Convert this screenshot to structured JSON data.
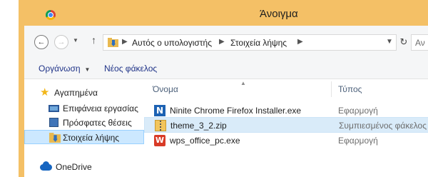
{
  "window": {
    "title": "Άνοιγμα",
    "colors": {
      "frame": "#f4c066",
      "selection": "#cce8ff",
      "link": "#1e3287"
    }
  },
  "nav": {
    "back_icon": "back-arrow-icon",
    "forward_icon": "forward-arrow-icon",
    "up_icon": "up-arrow-icon",
    "breadcrumb": [
      "Αυτός ο υπολογιστής",
      "Στοιχεία λήψης"
    ],
    "search_placeholder": "Αν"
  },
  "commands": {
    "organize": "Οργάνωση",
    "new_folder": "Νέος φάκελος"
  },
  "sidebar": {
    "items": [
      {
        "label": "Αγαπημένα",
        "icon": "star-icon"
      },
      {
        "label": "Επιφάνεια εργασίας",
        "icon": "desktop-icon"
      },
      {
        "label": "Πρόσφατες θέσεις",
        "icon": "recent-places-icon"
      },
      {
        "label": "Στοιχεία λήψης",
        "icon": "downloads-folder-icon"
      },
      {
        "label": "OneDrive",
        "icon": "onedrive-icon"
      }
    ]
  },
  "filelist": {
    "columns": {
      "name": "Όνομα",
      "type": "Τύπος"
    },
    "rows": [
      {
        "name": "Ninite Chrome Firefox Installer.exe",
        "type": "Εφαρμογή",
        "icon": "ninite-icon"
      },
      {
        "name": "theme_3_2.zip",
        "type": "Συμπιεσμένος φάκελος",
        "icon": "zip-folder-icon"
      },
      {
        "name": "wps_office_pc.exe",
        "type": "Εφαρμογή",
        "icon": "wps-icon"
      }
    ]
  }
}
